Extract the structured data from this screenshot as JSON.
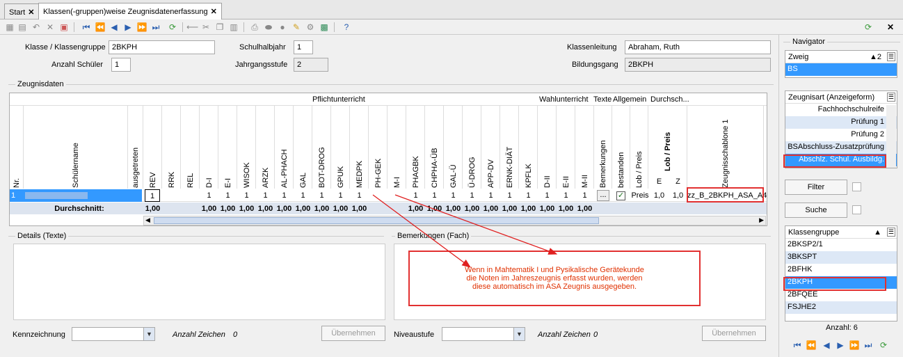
{
  "tabs": [
    {
      "label": "Start"
    },
    {
      "label": "Klassen(-gruppen)weise Zeugnisdatenerfassung"
    }
  ],
  "form": {
    "klasse_label": "Klasse / Klassengruppe",
    "klasse_value": "2BKPH",
    "halbjahr_label": "Schulhalbjahr",
    "halbjahr_value": "1",
    "leitung_label": "Klassenleitung",
    "leitung_value": "Abraham, Ruth",
    "anzahl_label": "Anzahl Schüler",
    "anzahl_value": "1",
    "stufe_label": "Jahrgangsstufe",
    "stufe_value": "2",
    "bildungsgang_label": "Bildungsgang",
    "bildungsgang_value": "2BKPH"
  },
  "grid": {
    "section_label": "Zeugnisdaten",
    "group_pflicht": "Pflichtunterricht",
    "group_wahl": "Wahlunterricht",
    "group_texte": "Texte",
    "group_allgemein": "Allgemein",
    "group_durchsch": "Durchsch...",
    "col_nr": "Nr.",
    "col_schuelername": "Schülername",
    "col_ausgetreten": "ausgetreten",
    "subjects": [
      "REV",
      "RRK",
      "REL",
      "D-I",
      "E-I",
      "WISOK",
      "ARZK",
      "AL-PHACH",
      "GAL",
      "BOT-DROG",
      "GPUK",
      "MEDPK",
      "PH-GEK",
      "M-I",
      "PHAGBK",
      "CHPHA-ÜB",
      "GAL-Ü",
      "Ü-DROG",
      "APP-DV",
      "ERNK-DIÄT",
      "KPFLK",
      "D-II",
      "E-II",
      "M-II"
    ],
    "col_bemerkungen": "Bemerkungen",
    "col_bestanden": "bestanden",
    "col_lobpreis": "Lob / Preis",
    "col_lobpreis2": "Lob / Preis",
    "col_e": "E",
    "col_z": "Z",
    "col_schablone": "Zeugnisschablone 1",
    "row_nr": "1",
    "row_values": [
      "1",
      "",
      "",
      "1",
      "1",
      "1",
      "1",
      "1",
      "1",
      "1",
      "1",
      "1",
      "",
      "",
      "1",
      "1",
      "1",
      "1",
      "1",
      "1",
      "1",
      "1",
      "1",
      "1"
    ],
    "row_bem_btn": "...",
    "row_lob": "Preis",
    "row_e": "1,0",
    "row_z": "1,0",
    "row_schablone": "zz_B_2BKPH_ASA_A4",
    "avg_label": "Durchschnitt:",
    "avg_values": [
      "1,00",
      "",
      "",
      "1,00",
      "1,00",
      "1,00",
      "1,00",
      "1,00",
      "1,00",
      "1,00",
      "1,00",
      "1,00",
      "",
      "",
      "1,00",
      "1,00",
      "1,00",
      "1,00",
      "1,00",
      "1,00",
      "1,00",
      "1,00",
      "1,00",
      "1,00"
    ]
  },
  "details": {
    "label": "Details (Texte)",
    "bemerkungen_label": "Bemerkungen (Fach)",
    "note": [
      "Wenn in Mahtematik I und Pysikalische Gerätekunde",
      "die Noten im Jahreszeugnis erfasst wurden, werden",
      "diese automatisch im ASA Zeugnis ausgegeben."
    ],
    "kennzeichnung_label": "Kennzeichnung",
    "anzahl_zeichen_label": "Anzahl Zeichen",
    "anzahl_zeichen_value": "0",
    "uebernehmen": "Übernehmen",
    "niveau_label": "Niveaustufe",
    "anzahl_zeichen2_value": "0",
    "uebernehmen2": "Übernehmen"
  },
  "navigator": {
    "title": "Navigator",
    "zweig_header": "Zweig",
    "zweig_count": "2",
    "zweig_items": [
      "BS"
    ],
    "zeugnisart_header": "Zeugnisart (Anzeigeform)",
    "zeugnisart_items": [
      "Fachhochschulreife",
      "Prüfung 1",
      "Prüfung 2",
      "BSAbschluss-Zusatzprüfung",
      "Abschlz. Schul. Ausbildg."
    ],
    "filter": "Filter",
    "suche": "Suche",
    "klassen_header": "Klassengruppe",
    "klassen_items": [
      "2BKSP2/1",
      "3BKSPT",
      "2BFHK",
      "2BKPH",
      "2BFQEE",
      "FSJHE2"
    ],
    "anzahl": "Anzahl: 6"
  },
  "colors": {
    "accent": "#3399ff",
    "highlight": "#e23030",
    "note_text": "#e03000"
  }
}
